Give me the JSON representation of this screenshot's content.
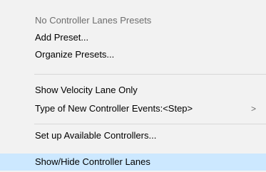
{
  "menu": {
    "items": [
      {
        "label": "No Controller Lanes Presets",
        "enabled": false
      },
      {
        "label": "Add Preset..."
      },
      {
        "label": "Organize Presets..."
      },
      {
        "label": "Show Velocity Lane Only"
      },
      {
        "label": "Type of New Controller Events:<Step>",
        "submenu_icon": "chevron-right-icon",
        "submenu_glyph": ">"
      },
      {
        "label": "Set up Available Controllers..."
      },
      {
        "label": "Show/Hide Controller Lanes",
        "highlighted": true
      }
    ]
  },
  "colors": {
    "menu_background": "#f2f2f2",
    "highlight": "#cce8ff",
    "disabled_text": "#6d6d6d",
    "separator": "#d7d7d7"
  }
}
